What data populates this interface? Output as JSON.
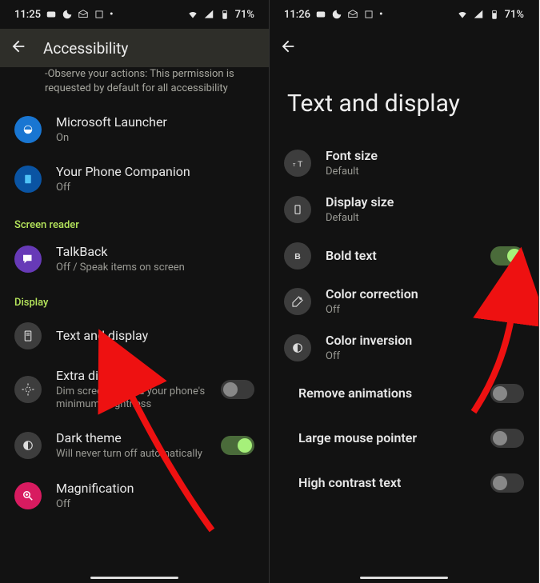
{
  "left": {
    "status": {
      "time": "11:25",
      "battery": "71%"
    },
    "appbar_title": "Accessibility",
    "partial": "-Observe your actions: This permission is requested by default for all accessibility",
    "rows": {
      "ms_launcher": {
        "title": "Microsoft Launcher",
        "sub": "On"
      },
      "your_phone": {
        "title": "Your Phone Companion",
        "sub": "Off"
      }
    },
    "section_reader": "Screen reader",
    "talkback": {
      "title": "TalkBack",
      "sub": "Off / Speak items on screen"
    },
    "section_display": "Display",
    "text_display": {
      "title": "Text and display"
    },
    "extra_dim": {
      "title": "Extra dim",
      "sub": "Dim screen beyond your phone's minimum brightness"
    },
    "dark_theme": {
      "title": "Dark theme",
      "sub": "Will never turn off automatically"
    },
    "magnification": {
      "title": "Magnification",
      "sub": "Off"
    }
  },
  "right": {
    "status": {
      "time": "11:26",
      "battery": "71%"
    },
    "page_title": "Text and display",
    "font_size": {
      "title": "Font size",
      "sub": "Default"
    },
    "display_size": {
      "title": "Display size",
      "sub": "Default"
    },
    "bold_text": {
      "title": "Bold text"
    },
    "color_correction": {
      "title": "Color correction",
      "sub": "Off"
    },
    "color_inversion": {
      "title": "Color inversion",
      "sub": "Off"
    },
    "remove_anim": {
      "title": "Remove animations"
    },
    "large_pointer": {
      "title": "Large mouse pointer"
    },
    "high_contrast": {
      "title": "High contrast text"
    }
  }
}
